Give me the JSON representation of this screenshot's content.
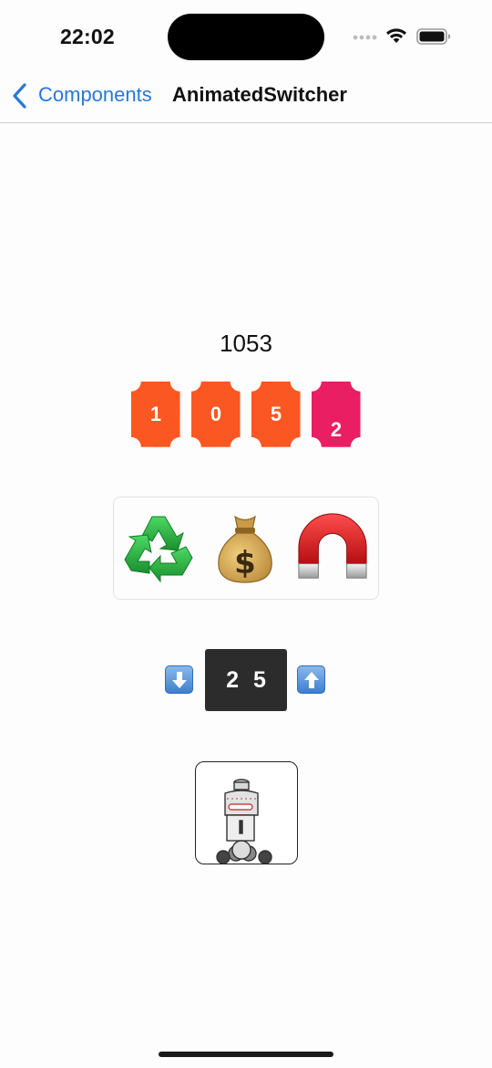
{
  "status_bar": {
    "time": "22:02"
  },
  "nav": {
    "back_label": "Components",
    "title": "AnimatedSwitcher"
  },
  "counter": {
    "value": "1053",
    "digits": [
      "1",
      "0",
      "5",
      "2"
    ]
  },
  "emoji_switcher": {
    "items": [
      "recycling-symbol",
      "money-bag",
      "magnet"
    ]
  },
  "stepper": {
    "digits": [
      "2",
      "5"
    ],
    "decrement_icon": "down-arrow-icon",
    "increment_icon": "up-arrow-icon"
  },
  "robot_card": {
    "image": "robot-illustration"
  },
  "colors": {
    "accent_blue": "#2878d8",
    "digit_orange": "#fb5722",
    "digit_pink": "#e91e63",
    "stepper_dark": "#2c2c2c"
  }
}
